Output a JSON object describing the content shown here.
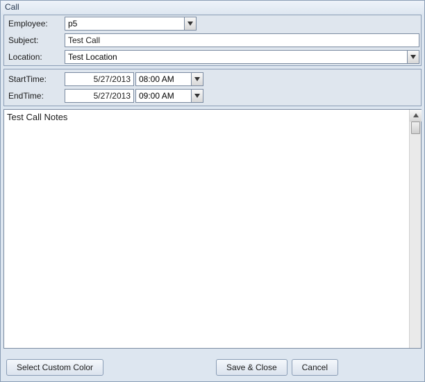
{
  "window": {
    "title": "Call"
  },
  "labels": {
    "employee": "Employee:",
    "subject": "Subject:",
    "location": "Location:",
    "startTime": "StartTime:",
    "endTime": "EndTime:"
  },
  "fields": {
    "employee": "p5",
    "subject": "Test Call",
    "location": "Test Location",
    "startDate": "5/27/2013",
    "startTime": "08:00 AM",
    "endDate": "5/27/2013",
    "endTime": "09:00 AM",
    "notes": "Test Call Notes"
  },
  "buttons": {
    "selectColor": "Select Custom Color",
    "saveClose": "Save & Close",
    "cancel": "Cancel"
  }
}
